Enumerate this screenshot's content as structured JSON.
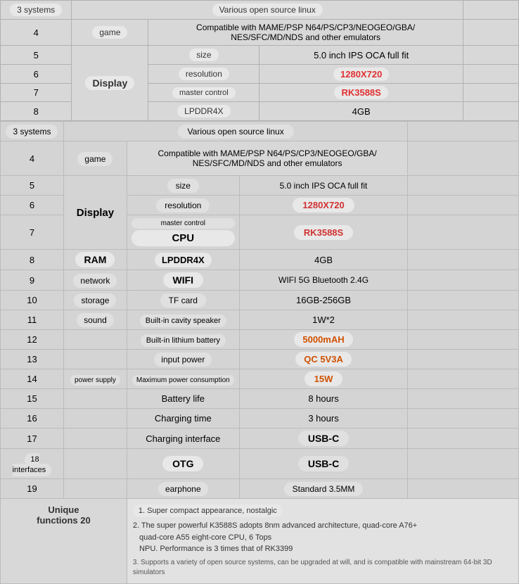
{
  "rows": [
    {
      "num": "3 systems",
      "cat": "",
      "spec": "Various open source linux",
      "val": "",
      "numStyle": "badge",
      "specStyle": "badge-dark",
      "valStyle": ""
    },
    {
      "num": "4",
      "cat": "game",
      "spec": "Compatible with MAME/PSP N64/PS/CP3/NEOGEO/GBA/NES/SFC/MD/NDS and other emulators",
      "val": "",
      "numStyle": "plain",
      "catStyle": "badge",
      "specStyle": "plain",
      "valStyle": ""
    },
    {
      "num": "5",
      "cat": "Display",
      "spec": "size",
      "val": "5.0 inch IPS OCA full fit",
      "numStyle": "plain",
      "catStyle": "badge-big",
      "specStyle": "badge",
      "valStyle": "plain"
    },
    {
      "num": "6",
      "cat": "",
      "spec": "resolution",
      "val": "1280X720",
      "numStyle": "plain",
      "specStyle": "badge",
      "valStyle": "red"
    },
    {
      "num": "7",
      "cat": "master control",
      "spec": "CPU",
      "val": "RK3588S",
      "numStyle": "plain",
      "catStyle": "badge-small",
      "specStyle": "badge-big",
      "valStyle": "red"
    },
    {
      "num": "8",
      "cat": "RAM",
      "spec": "LPDDR4X",
      "val": "4GB",
      "numStyle": "plain",
      "catStyle": "badge-big",
      "specStyle": "badge-big",
      "valStyle": "plain"
    },
    {
      "num": "9",
      "cat": "network",
      "spec": "WIFI",
      "val": "WIFI 5G Bluetooth 2.4G",
      "numStyle": "plain",
      "catStyle": "badge",
      "specStyle": "badge-big",
      "valStyle": "plain"
    },
    {
      "num": "10",
      "cat": "storage",
      "spec": "TF card",
      "val": "16GB-256GB",
      "numStyle": "plain",
      "catStyle": "badge",
      "specStyle": "badge",
      "valStyle": "plain"
    },
    {
      "num": "11",
      "cat": "sound",
      "spec": "Built-in cavity speaker",
      "val": "1W*2",
      "numStyle": "plain",
      "catStyle": "badge",
      "specStyle": "badge",
      "valStyle": "plain"
    },
    {
      "num": "12",
      "cat": "",
      "spec": "Built-in lithium battery",
      "val": "5000mAH",
      "numStyle": "plain",
      "specStyle": "badge",
      "valStyle": "orange"
    },
    {
      "num": "13",
      "cat": "",
      "spec": "input power",
      "val": "QC 5V3A",
      "numStyle": "plain",
      "specStyle": "badge",
      "valStyle": "orange"
    },
    {
      "num": "14",
      "cat": "power supply",
      "spec": "Maximum power consumption",
      "val": "15W",
      "numStyle": "plain",
      "catStyle": "badge-small",
      "specStyle": "badge-small",
      "valStyle": "orange"
    },
    {
      "num": "15",
      "cat": "",
      "spec": "Battery life",
      "val": "8 hours",
      "numStyle": "plain",
      "specStyle": "plain",
      "valStyle": "plain"
    },
    {
      "num": "16",
      "cat": "",
      "spec": "Charging time",
      "val": "3 hours",
      "numStyle": "plain",
      "specStyle": "plain",
      "valStyle": "plain"
    },
    {
      "num": "17",
      "cat": "",
      "spec": "Charging interface",
      "val": "USB-C",
      "numStyle": "plain",
      "specStyle": "plain",
      "valStyle": "badge-dark-big"
    },
    {
      "num": "18 interfaces",
      "cat": "",
      "spec": "OTG",
      "val": "USB-C",
      "numStyle": "badge",
      "specStyle": "badge-big",
      "valStyle": "badge-dark-big"
    },
    {
      "num": "19",
      "cat": "",
      "spec": "earphone",
      "val": "Standard 3.5MM",
      "numStyle": "plain",
      "specStyle": "badge",
      "valStyle": "badge-dark"
    }
  ],
  "notes": [
    "1. Super compact appearance, nostalgic",
    "2. The super powerful K3588S adopts 8nm advanced architecture, quad-core A76+quad-core A55 eight-core CPU, 6 Tops NPU. Performance is 3 times that of RK3399",
    "3. Supports a variety of open source systems, can be upgraded at will, and is compatible with mainstream 64-bit 3D simulators"
  ],
  "unique_label": "Unique functions 20"
}
